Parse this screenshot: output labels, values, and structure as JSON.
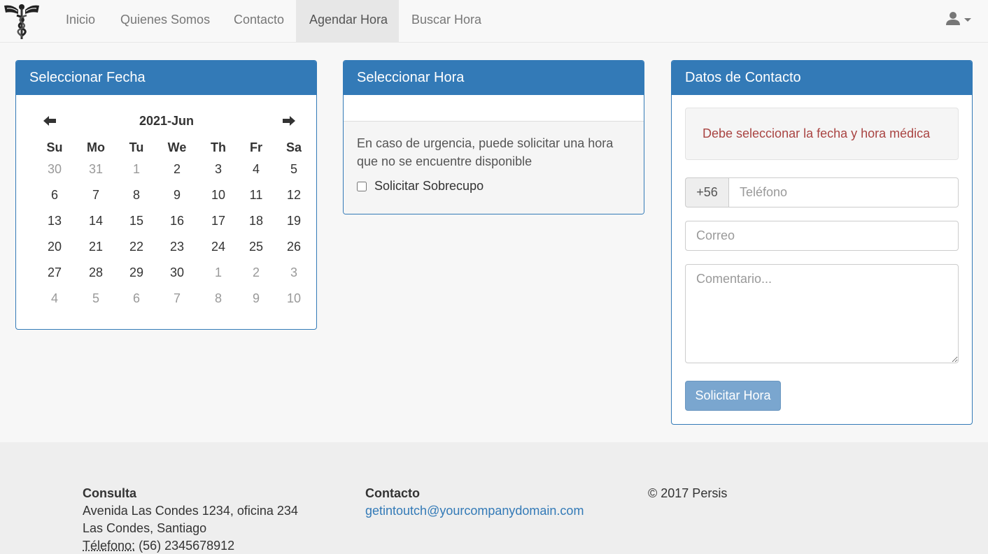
{
  "nav": {
    "items": [
      {
        "label": "Inicio",
        "active": false
      },
      {
        "label": "Quienes Somos",
        "active": false
      },
      {
        "label": "Contacto",
        "active": false
      },
      {
        "label": "Agendar Hora",
        "active": true
      },
      {
        "label": "Buscar Hora",
        "active": false
      }
    ],
    "user_icon": "user-icon"
  },
  "date_panel": {
    "title": "Seleccionar Fecha",
    "month_label": "2021-Jun",
    "weekdays": [
      "Su",
      "Mo",
      "Tu",
      "We",
      "Th",
      "Fr",
      "Sa"
    ],
    "weeks": [
      [
        {
          "d": "30",
          "o": true
        },
        {
          "d": "31",
          "o": true
        },
        {
          "d": "1",
          "o": false,
          "dim": true
        },
        {
          "d": "2"
        },
        {
          "d": "3"
        },
        {
          "d": "4"
        },
        {
          "d": "5"
        }
      ],
      [
        {
          "d": "6"
        },
        {
          "d": "7"
        },
        {
          "d": "8"
        },
        {
          "d": "9"
        },
        {
          "d": "10"
        },
        {
          "d": "11"
        },
        {
          "d": "12"
        }
      ],
      [
        {
          "d": "13"
        },
        {
          "d": "14"
        },
        {
          "d": "15"
        },
        {
          "d": "16"
        },
        {
          "d": "17"
        },
        {
          "d": "18"
        },
        {
          "d": "19"
        }
      ],
      [
        {
          "d": "20"
        },
        {
          "d": "21"
        },
        {
          "d": "22"
        },
        {
          "d": "23"
        },
        {
          "d": "24"
        },
        {
          "d": "25"
        },
        {
          "d": "26"
        }
      ],
      [
        {
          "d": "27"
        },
        {
          "d": "28"
        },
        {
          "d": "29"
        },
        {
          "d": "30"
        },
        {
          "d": "1",
          "o": true
        },
        {
          "d": "2",
          "o": true
        },
        {
          "d": "3",
          "o": true
        }
      ],
      [
        {
          "d": "4",
          "o": true
        },
        {
          "d": "5",
          "o": true
        },
        {
          "d": "6",
          "o": true
        },
        {
          "d": "7",
          "o": true
        },
        {
          "d": "8",
          "o": true
        },
        {
          "d": "9",
          "o": true
        },
        {
          "d": "10",
          "o": true
        }
      ]
    ]
  },
  "hour_panel": {
    "title": "Seleccionar Hora",
    "note": "En caso de urgencia, puede solicitar una hora que no se encuentre disponible",
    "overbook_label": "Solicitar Sobrecupo"
  },
  "contact_panel": {
    "title": "Datos de Contacto",
    "alert": "Debe seleccionar la fecha y hora médica",
    "phone_prefix": "+56",
    "phone_placeholder": "Teléfono",
    "email_placeholder": "Correo",
    "comment_placeholder": "Comentario...",
    "submit_label": "Solicitar Hora"
  },
  "footer": {
    "consulta_title": "Consulta",
    "address1": "Avenida Las Condes 1234, oficina 234",
    "address2": "Las Condes, Santiago",
    "phone_label": "Télefono:",
    "phone_value": "(56) 2345678912",
    "contact_title": "Contacto",
    "email": "getintoutch@yourcompanydomain.com",
    "copyright": "© 2017 Persis"
  },
  "colors": {
    "primary": "#337ab7",
    "alert_text": "#a94442"
  }
}
